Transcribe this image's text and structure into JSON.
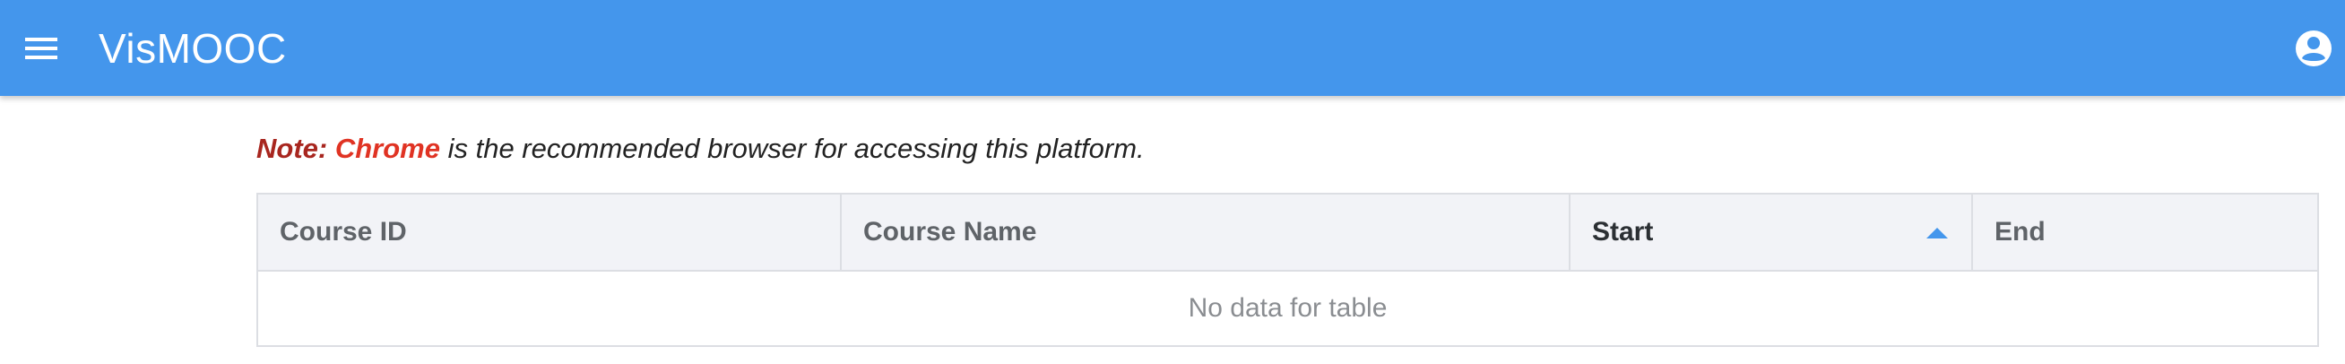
{
  "appbar": {
    "title": "VisMOOC",
    "menu_icon": "hamburger-menu-icon",
    "account_icon": "account-circle-icon",
    "background_color": "#4496ec"
  },
  "note": {
    "label": "Note:",
    "browser": "Chrome",
    "message": " is the recommended browser for accessing this platform."
  },
  "table": {
    "columns": [
      {
        "label": "Course ID"
      },
      {
        "label": "Course Name"
      },
      {
        "label": "Start",
        "sorted": "ascending"
      },
      {
        "label": "End"
      }
    ],
    "empty_message": "No data for table"
  }
}
